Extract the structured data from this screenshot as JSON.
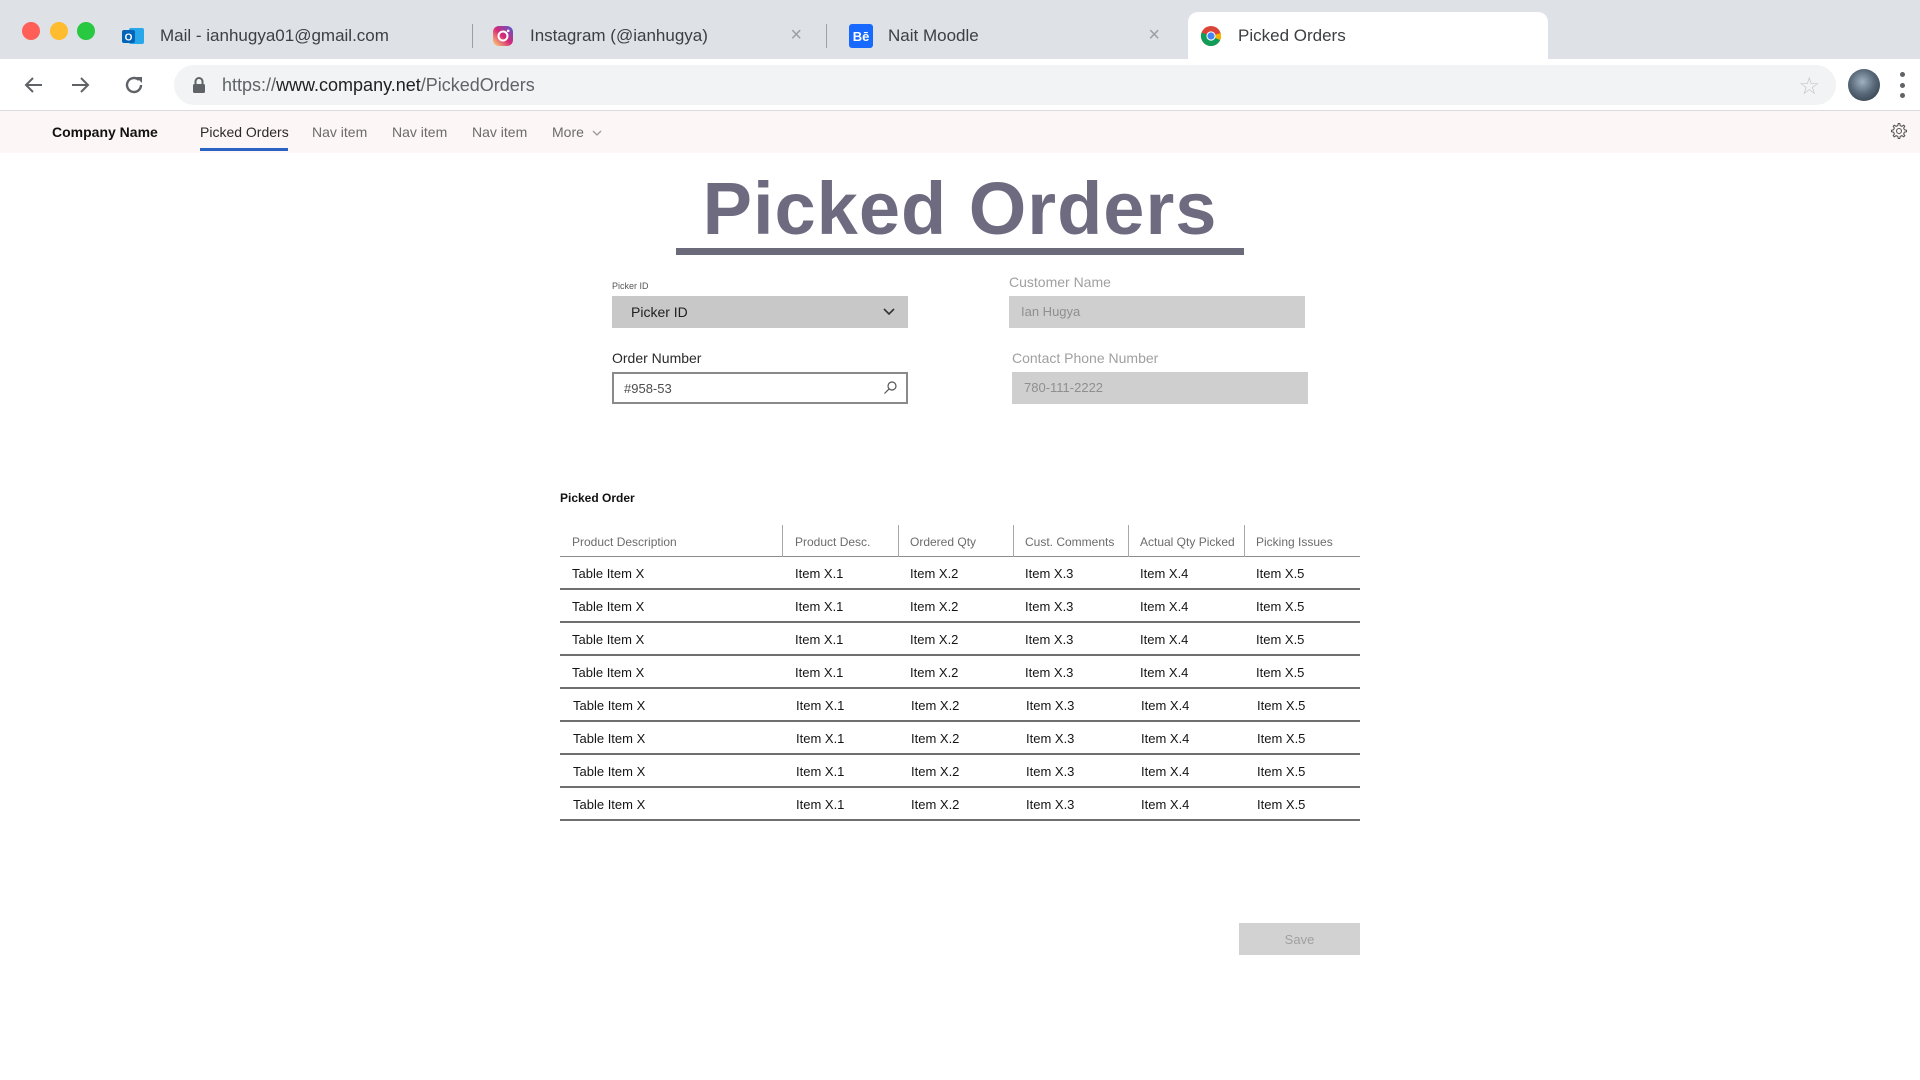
{
  "browser": {
    "tabs": [
      {
        "title": "Mail - ianhugya01@gmail.com",
        "icon": "outlook-icon"
      },
      {
        "title": "Instagram (@ianhugya)",
        "icon": "instagram-icon"
      },
      {
        "title": "Nait Moodle",
        "icon": "behance-icon"
      },
      {
        "title": "Picked Orders",
        "icon": "chrome-icon"
      }
    ],
    "url_prefix": "https://",
    "url_domain": "www.company.net",
    "url_path": "/PickedOrders",
    "close_glyph": "×"
  },
  "appnav": {
    "brand": "Company Name",
    "items": [
      "Picked Orders",
      "Nav item",
      "Nav item",
      "Nav item",
      "More"
    ],
    "active_index": 0
  },
  "page": {
    "title": "Picked Orders"
  },
  "form": {
    "picker_small_label": "Picker ID",
    "picker_value": "Picker ID",
    "customer_label": "Customer Name",
    "customer_value": "Ian Hugya",
    "order_label": "Order Number",
    "order_value": "#958-53",
    "phone_label": "Contact Phone Number",
    "phone_value": "780-111-2222"
  },
  "table": {
    "title": "Picked Order",
    "columns": [
      "Product Description",
      "Product Desc.",
      "Ordered Qty",
      "Cust. Comments",
      "Actual Qty Picked",
      "Picking Issues"
    ],
    "rows": [
      [
        "Table Item X",
        "Item X.1",
        "Item X.2",
        "Item X.3",
        "Item X.4",
        "Item X.5"
      ],
      [
        "Table Item X",
        "Item X.1",
        "Item X.2",
        "Item X.3",
        "Item X.4",
        "Item X.5"
      ],
      [
        "Table Item X",
        "Item X.1",
        "Item X.2",
        "Item X.3",
        "Item X.4",
        "Item X.5"
      ],
      [
        "Table Item X",
        "Item X.1",
        "Item X.2",
        "Item X.3",
        "Item X.4",
        "Item X.5"
      ],
      [
        "Table Item X",
        "Item X.1",
        "Item X.2",
        "Item X.3",
        "Item X.4",
        "Item X.5"
      ],
      [
        "Table Item X",
        "Item X.1",
        "Item X.2",
        "Item X.3",
        "Item X.4",
        "Item X.5"
      ],
      [
        "Table Item X",
        "Item X.1",
        "Item X.2",
        "Item X.3",
        "Item X.4",
        "Item X.5"
      ],
      [
        "Table Item X",
        "Item X.1",
        "Item X.2",
        "Item X.3",
        "Item X.4",
        "Item X.5"
      ]
    ]
  },
  "actions": {
    "save_label": "Save"
  },
  "colors": {
    "accent": "#2a63c4",
    "title": "#6e6b80",
    "nav_bg": "#fdf6f6"
  }
}
